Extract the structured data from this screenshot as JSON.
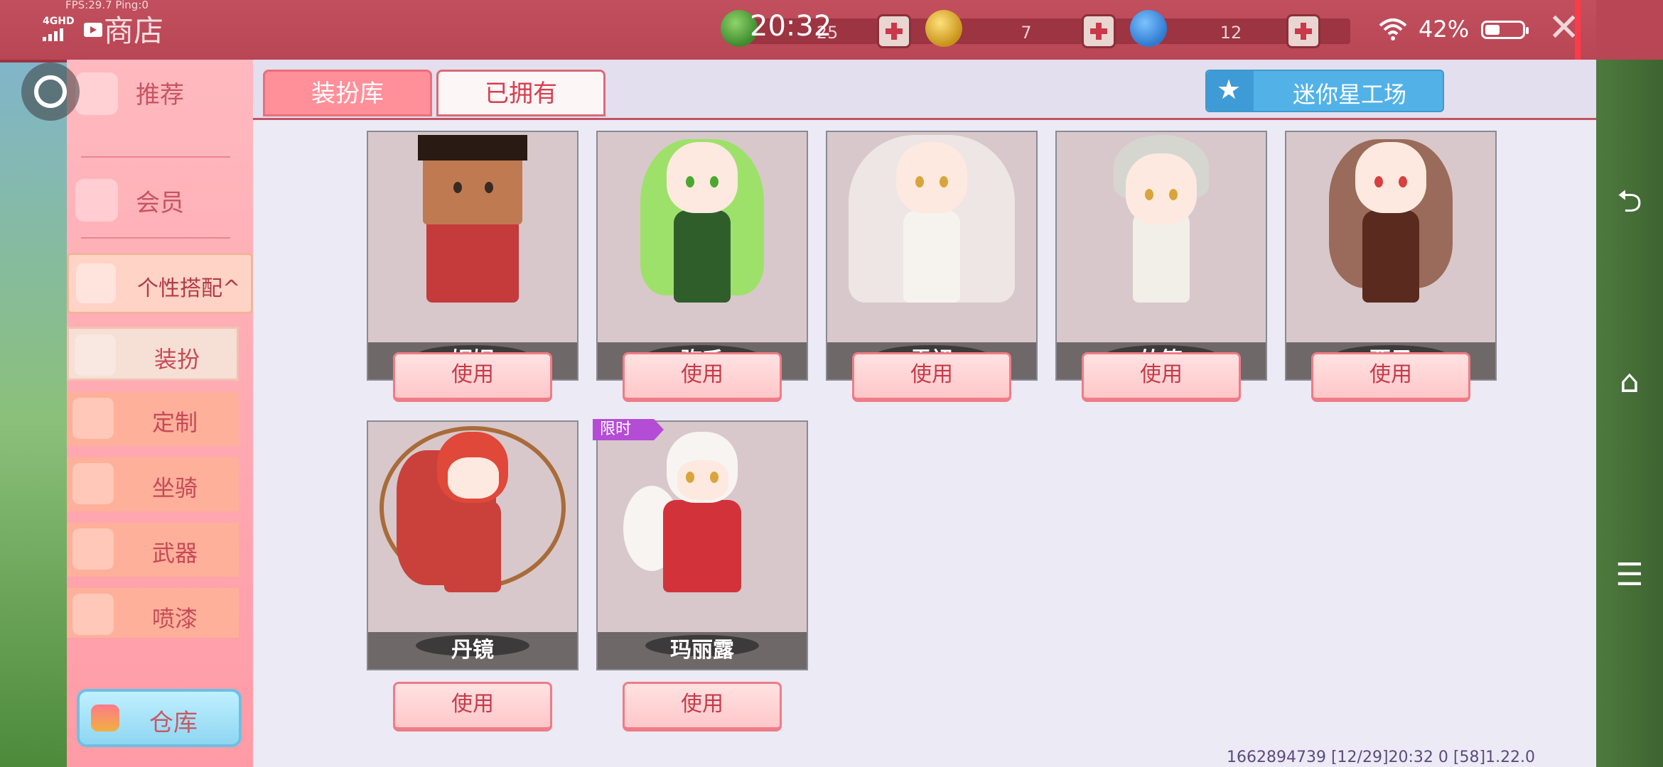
{
  "status_bar": {
    "fps": "FPS:29.7 Ping:0",
    "network": "4GHD",
    "time": "20:32",
    "battery": "42%"
  },
  "header": {
    "title": "商店",
    "resources": [
      {
        "icon": "green-coin-icon",
        "value": "25",
        "color": "#3e8a2e"
      },
      {
        "icon": "gold-coin-icon",
        "value": "7",
        "color": "#e2b11e"
      },
      {
        "icon": "blue-coin-icon",
        "value": "12",
        "color": "#2f7ad0"
      }
    ]
  },
  "sidebar": {
    "items": [
      {
        "label": "推荐"
      },
      {
        "label": "会员"
      },
      {
        "label": "个性搭配^"
      },
      {
        "label": "装扮"
      },
      {
        "label": "定制"
      },
      {
        "label": "坐骑"
      },
      {
        "label": "武器"
      },
      {
        "label": "喷漆"
      }
    ],
    "warehouse": "仓库"
  },
  "tabs": [
    {
      "label": "装扮库"
    },
    {
      "label": "已拥有"
    }
  ],
  "workshop": "迷你星工场",
  "skins": [
    {
      "name": "妮妮",
      "button": "使用",
      "hair": "#2a1a14",
      "outfit": "#c53a3a",
      "skin": "#c07a52"
    },
    {
      "name": "弥禾",
      "button": "使用",
      "hair": "#9ee16a",
      "outfit": "#2f5e2a",
      "skin": "#fde9df"
    },
    {
      "name": "雪裙",
      "button": "使用",
      "hair": "#e8e4e0",
      "outfit": "#f6f2ee",
      "skin": "#fde9df"
    },
    {
      "name": "竹笙",
      "button": "使用",
      "hair": "#d6d6d0",
      "outfit": "#f1efe8",
      "skin": "#fde9df"
    },
    {
      "name": "栗子",
      "button": "使用",
      "hair": "#9a6b5a",
      "outfit": "#5a2a1e",
      "skin": "#fde9df"
    },
    {
      "name": "丹镜",
      "button": "使用",
      "hair": "#e0483a",
      "outfit": "#c9413a",
      "skin": "#fde9df"
    },
    {
      "name": "玛丽露",
      "button": "使用",
      "hair": "#f7f4f1",
      "outfit": "#d2333a",
      "skin": "#fde9df",
      "badge": "限时"
    }
  ],
  "footer": "1662894739  [12/29]20:32 0  [58]1.22.0"
}
